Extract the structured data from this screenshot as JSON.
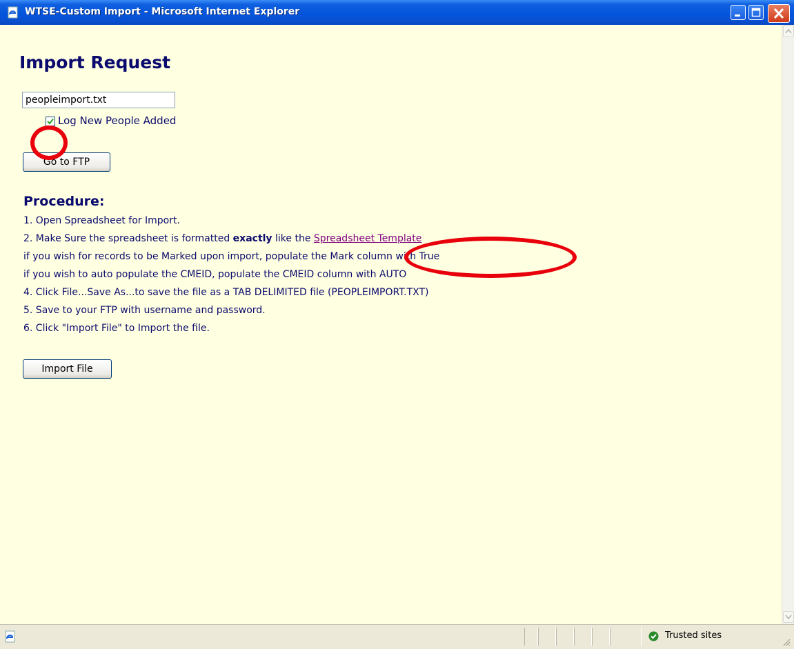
{
  "window": {
    "title": "WTSE-Custom Import - Microsoft Internet Explorer",
    "title_icon": "ie-page-icon",
    "controls": [
      "minimize-icon",
      "maximize-icon",
      "close-icon"
    ]
  },
  "page": {
    "title": "Import Request",
    "file_input_value": "peopleimport.txt",
    "log_checkbox_label": "Log New People Added",
    "log_checkbox_checked": true,
    "go_ftp_label": "Go to FTP",
    "procedure_heading": "Procedure:",
    "steps": [
      {
        "text": "1. Open Spreadsheet for Import."
      },
      {
        "pre": "2. Make Sure the spreadsheet is formatted ",
        "bold": "exactly",
        "mid": " like the ",
        "link": "Spreadsheet Template"
      },
      {
        "text": "if you wish for records to be Marked upon import, populate the Mark column with True"
      },
      {
        "text": "if you wish to auto populate the CMEID, populate the CMEID column with AUTO"
      },
      {
        "text": "4. Click File...Save As...to save the file as a TAB DELIMITED file (PEOPLEIMPORT.TXT)"
      },
      {
        "text": "5. Save to your FTP with username and password."
      },
      {
        "text": "6. Click \"Import File\" to Import the file."
      }
    ],
    "import_file_label": "Import File"
  },
  "status": {
    "zone_text": "Trusted sites",
    "zone_icon": "trusted-sites-check-icon"
  },
  "colors": {
    "page_background": "#ffffe1",
    "text": "#0a0a6e",
    "link": "#800080",
    "annotation": "#e8000b",
    "titlebar": "#0454dc"
  }
}
